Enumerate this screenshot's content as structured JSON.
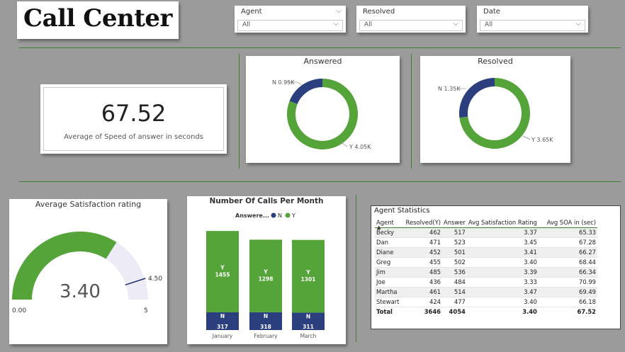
{
  "title": "Call Center",
  "slicers": [
    {
      "label": "Agent",
      "value": "All"
    },
    {
      "label": "Resolved",
      "value": "All"
    },
    {
      "label": "Date",
      "value": "All"
    }
  ],
  "kpi": {
    "value": "67.52",
    "caption": "Average of Speed of answer in seconds"
  },
  "answered_chart": {
    "title": "Answered",
    "slices": [
      {
        "label": "N 0.95K",
        "value": 0.95,
        "color": "#2b3f7e"
      },
      {
        "label": "Y 4.05K",
        "value": 4.05,
        "color": "#55a43a"
      }
    ]
  },
  "resolved_chart": {
    "title": "Resolved",
    "slices": [
      {
        "label": "N 1.35K",
        "value": 1.35,
        "color": "#2b3f7e"
      },
      {
        "label": "Y 3.65K",
        "value": 3.65,
        "color": "#55a43a"
      }
    ]
  },
  "gauge": {
    "title": "Average Satisfaction rating",
    "value": 3.4,
    "value_label": "3.40",
    "min_label": "0.00",
    "max_label": "5",
    "target_label": "4.50",
    "min": 0,
    "max": 5,
    "target": 4.5,
    "fill_color": "#55a43a",
    "track_color": "#ecebf6",
    "target_color": "#1f2c6b"
  },
  "calls_chart": {
    "title": "Number Of Calls Per Month",
    "legend_title": "Answere...",
    "legend": [
      {
        "name": "N",
        "color": "#2b3f7e"
      },
      {
        "name": "Y",
        "color": "#55a43a"
      }
    ],
    "chart_data": {
      "type": "bar",
      "stacked": true,
      "title": "Number Of Calls Per Month",
      "categories": [
        "January",
        "February",
        "March"
      ],
      "series": [
        {
          "name": "N",
          "values": [
            317,
            318,
            311
          ],
          "color": "#2b3f7e"
        },
        {
          "name": "Y",
          "values": [
            1455,
            1298,
            1301
          ],
          "color": "#55a43a"
        }
      ]
    }
  },
  "agent_stats": {
    "title": "Agent Statistics",
    "columns": [
      "Agent",
      "Resolved(Y)",
      "Answer",
      "Avg Satisfaction Rating",
      "Avg SOA in (sec)"
    ],
    "rows": [
      [
        "Becky",
        "462",
        "517",
        "3.37",
        "65.33"
      ],
      [
        "Dan",
        "471",
        "523",
        "3.45",
        "67.28"
      ],
      [
        "Diane",
        "452",
        "501",
        "3.41",
        "66.27"
      ],
      [
        "Greg",
        "455",
        "502",
        "3.40",
        "68.44"
      ],
      [
        "Jim",
        "485",
        "536",
        "3.39",
        "66.34"
      ],
      [
        "Joe",
        "436",
        "484",
        "3.33",
        "70.99"
      ],
      [
        "Martha",
        "461",
        "514",
        "3.47",
        "69.49"
      ],
      [
        "Stewart",
        "424",
        "477",
        "3.40",
        "66.18"
      ]
    ],
    "total": [
      "Total",
      "3646",
      "4054",
      "3.40",
      "67.52"
    ]
  }
}
